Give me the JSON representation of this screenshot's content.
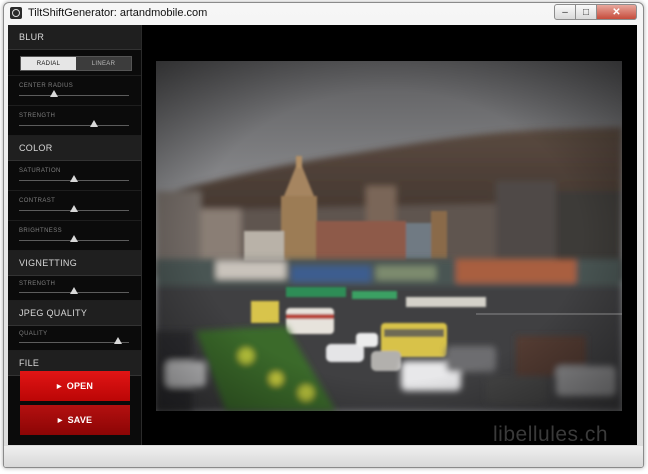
{
  "window": {
    "title": "TiltShiftGenerator: artandmobile.com",
    "minimize_glyph": "–",
    "maximize_glyph": "□",
    "close_glyph": "✕"
  },
  "sidebar": {
    "blur": {
      "title": "BLUR",
      "modes": [
        "RADIAL",
        "LINEAR"
      ],
      "selected_mode": "RADIAL",
      "center_radius": {
        "label": "CENTER RADIUS",
        "value": 0.32
      },
      "strength": {
        "label": "STRENGTH",
        "value": 0.68
      }
    },
    "color": {
      "title": "COLOR",
      "saturation": {
        "label": "SATURATION",
        "value": 0.5
      },
      "contrast": {
        "label": "CONTRAST",
        "value": 0.5
      },
      "brightness": {
        "label": "BRIGHTNESS",
        "value": 0.5
      }
    },
    "vignetting": {
      "title": "VIGNETTING",
      "strength": {
        "label": "STRENGTH",
        "value": 0.5
      }
    },
    "jpeg_quality": {
      "title": "JPEG QUALITY",
      "quality": {
        "label": "QUALITY",
        "value": 0.9
      }
    },
    "file": {
      "title": "FILE",
      "open_label": "OPEN",
      "save_label": "SAVE"
    }
  },
  "watermark": "libellules.ch",
  "colors": {
    "accent": "#d40f0f",
    "panel": "#0b0b0b",
    "section_header": "#1f1f1f"
  },
  "icons": {
    "app": "app-icon",
    "button_arrow": "play-arrow-icon"
  }
}
